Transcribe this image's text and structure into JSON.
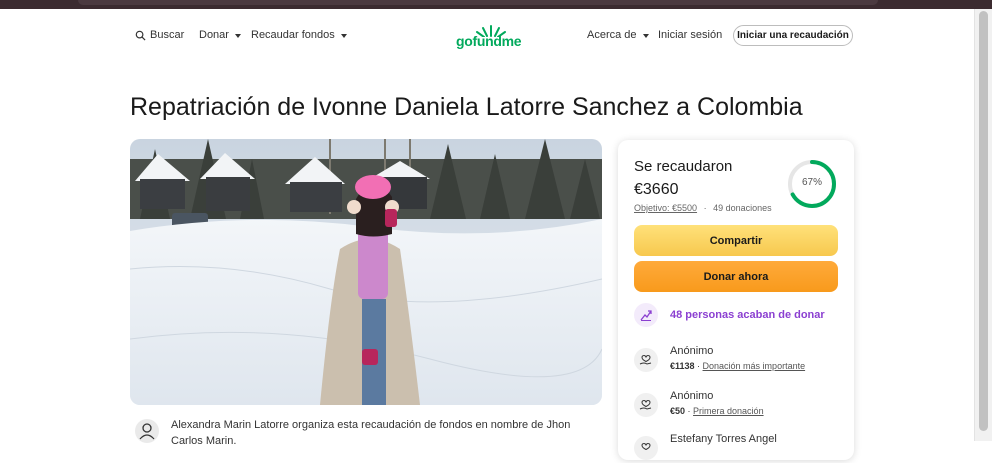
{
  "header": {
    "search_label": "Buscar",
    "donate_label": "Donar",
    "fundraise_label": "Recaudar fondos",
    "logo_text": "gofundme",
    "about_label": "Acerca de",
    "login_label": "Iniciar sesión",
    "start_label": "Iniciar una recaudación",
    "brand_color": "#02a95c"
  },
  "page": {
    "title": "Repatriación de Ivonne Daniela Latorre Sanchez a Colombia"
  },
  "organizer": {
    "text": "Alexandra Marin Latorre organiza esta recaudación de fondos en nombre de Jhon Carlos Marin."
  },
  "donation_card": {
    "raised_label": "Se recaudaron",
    "raised_amount": "€3660",
    "goal_label": "Objetivo: €5500",
    "separator": "·",
    "donations_count": "49 donaciones",
    "progress_percent": 67,
    "progress_label": "67%",
    "share_label": "Compartir",
    "donate_now_label": "Donar ahora",
    "recent_text": "48 personas acaban de donar",
    "donors": [
      {
        "name": "Anónimo",
        "amount": "€1138",
        "tag": "Donación más importante"
      },
      {
        "name": "Anónimo",
        "amount": "€50",
        "tag": "Primera donación"
      },
      {
        "name": "Estefany Torres Angel",
        "amount": "",
        "tag": ""
      }
    ],
    "accent_purple": "#8b3fd1",
    "share_color": "#f7c84e",
    "donate_color": "#f89a1c"
  }
}
